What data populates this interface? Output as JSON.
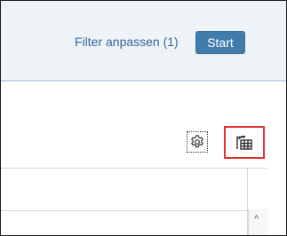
{
  "header": {
    "filter_link_label": "Filter anpassen (1)",
    "start_button_label": "Start"
  },
  "toolbar": {
    "settings_icon": "gear-icon",
    "export_icon": "export-to-spreadsheet-icon"
  },
  "table": {
    "scroll_up_glyph": "^"
  },
  "colors": {
    "header_background": "#eef3f8",
    "link_text": "#34669b",
    "start_button": "#427cac",
    "highlight_border": "#e1322d"
  }
}
